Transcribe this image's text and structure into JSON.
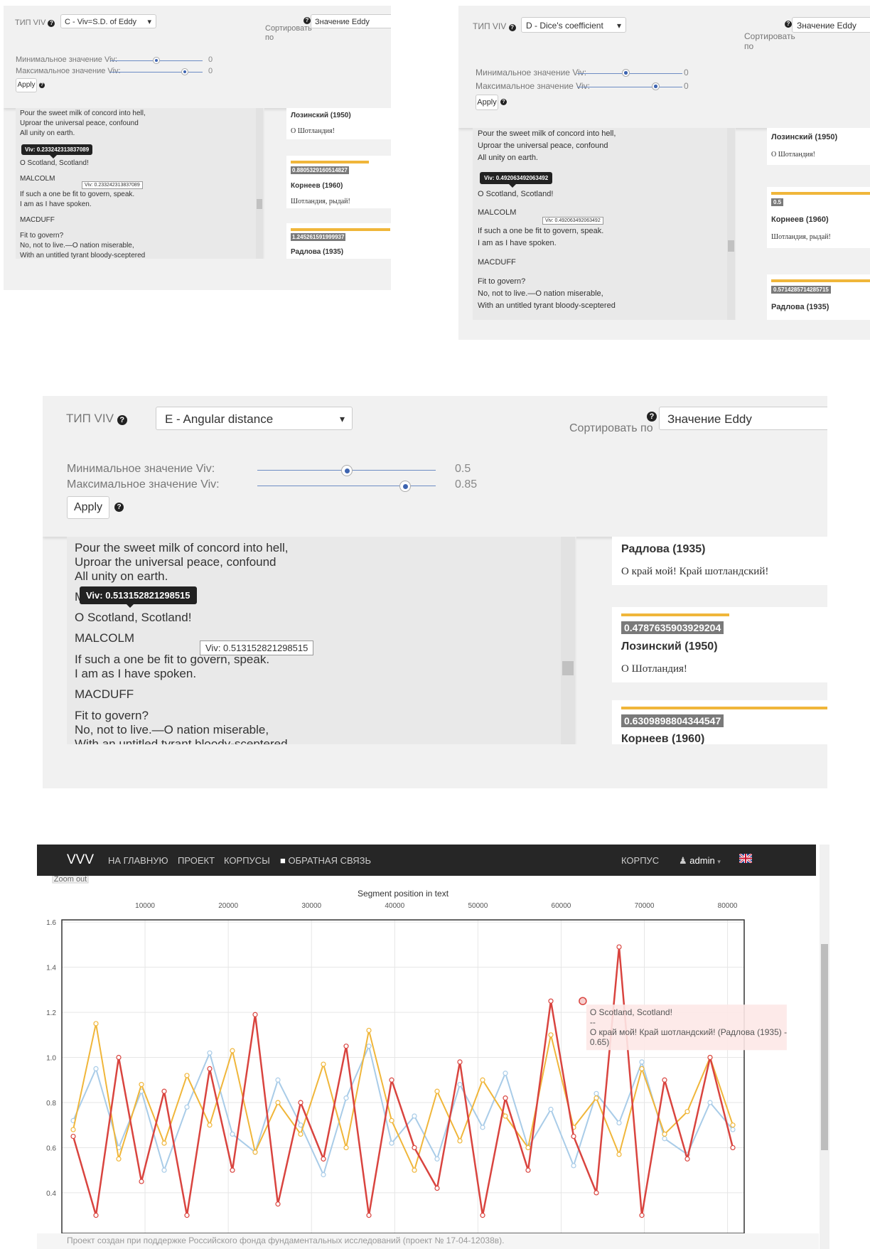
{
  "common": {
    "viv_type_label": "ТИП VIV",
    "help_glyph": "?",
    "sort_label": "Сортировать по",
    "sort_value": "Значение Eddy",
    "min_label": "Минимальное значение Viv:",
    "max_label": "Максимальное значение Viv:",
    "apply_label": "Apply",
    "caret": "▾",
    "text_lines": {
      "l1": "Pour the sweet milk of concord into hell,",
      "l2": "Uproar the universal peace, confound",
      "l3": "All unity on earth.",
      "l4": "O Scotland, Scotland!",
      "l5": "MALCOLM",
      "l6": "If such a one be fit to govern, speak.",
      "l7": "I am as I have spoken.",
      "l8": "MACDUFF",
      "l9": "Fit to govern?",
      "l10": "No, not to live.—O nation miserable,",
      "l11": "With an untitled tyrant bloody-sceptered"
    },
    "malcolm_initial": "M"
  },
  "panel1": {
    "viv_type": "C - Viv=S.D. of Eddy",
    "min_value": "0",
    "max_value": "0",
    "min_level": 0.42,
    "max_level": 0.7,
    "tooltip_dark": "Viv: 0.233242313837089",
    "tooltip_light": "Viv: 0.233242313837089",
    "cards": [
      {
        "score": "",
        "author": "Лозинский (1950)",
        "line": "О Шотландия!"
      },
      {
        "score": "0.8805329160514827",
        "author": "Корнеев (1960)",
        "line": "Шотландия, рыдай!"
      },
      {
        "score": "1.245261591999937",
        "author": "Радлова (1935)",
        "line": ""
      }
    ]
  },
  "panel2": {
    "viv_type": "D - Dice's coefficient",
    "min_value": "0",
    "max_value": "0",
    "min_level": 0.45,
    "max_level": 0.71,
    "tooltip_dark": "Viv: 0.492063492063492",
    "tooltip_light": "Viv: 0.492063492063492",
    "cards": [
      {
        "score": "",
        "author": "Лозинский (1950)",
        "line": "О Шотландия!"
      },
      {
        "score": "0.5",
        "author": "Корнеев (1960)",
        "line": "Шотландия, рыдай!"
      },
      {
        "score": "0.5714285714285715",
        "author": "Радлова (1935)",
        "line": ""
      }
    ]
  },
  "panel3": {
    "viv_type": "E - Angular distance",
    "min_value": "0.5",
    "max_value": "0.85",
    "min_level": 0.5,
    "max_level": 0.85,
    "tooltip_dark": "Viv: 0.513152821298515",
    "tooltip_light": "Viv: 0.513152821298515",
    "cards": [
      {
        "score": "",
        "author": "Радлова (1935)",
        "line": "О край мой! Край шотландский!"
      },
      {
        "score": "0.4787635903929204",
        "author": "Лозинский (1950)",
        "line": "О Шотландия!"
      },
      {
        "score": "0.6309898804344547",
        "author": "Корнеев (1960)",
        "line": ""
      }
    ]
  },
  "navbar": {
    "brand": "VVV",
    "items": [
      "НА ГЛАВНУЮ",
      "ПРОЕКТ",
      "КОРПУСЫ"
    ],
    "feedback": "ОБРАТНАЯ СВЯЗЬ",
    "corpus": "КОРПУС",
    "user": "admin",
    "flag": "gb-flag-icon"
  },
  "chart_data": {
    "type": "line",
    "title": "",
    "xlabel": "Segment position in text",
    "ylabel": "",
    "x_ticks": [
      10000,
      20000,
      30000,
      40000,
      50000,
      60000,
      70000,
      80000
    ],
    "y_ticks": [
      0.4,
      0.6,
      0.8,
      1.0,
      1.2,
      1.4,
      1.6
    ],
    "y_tick_labels": [
      "0.4",
      "0.6",
      "0.8",
      "1.0",
      "1.2",
      "1.4",
      "1.6"
    ],
    "xlim": [
      0,
      82000
    ],
    "ylim": [
      0.22,
      1.61
    ],
    "zoom_out_label": "Zoom out",
    "series": [
      {
        "color": "#a9cce8",
        "values": [
          0.72,
          0.95,
          0.6,
          0.85,
          0.5,
          0.78,
          1.02,
          0.66,
          0.58,
          0.9,
          0.7,
          0.48,
          0.82,
          1.05,
          0.62,
          0.74,
          0.55,
          0.88,
          0.69,
          0.93,
          0.6,
          0.77,
          0.52,
          0.84,
          0.71,
          0.98,
          0.64,
          0.57,
          0.8,
          0.68
        ]
      },
      {
        "color": "#f0b63a",
        "values": [
          0.68,
          1.15,
          0.55,
          0.88,
          0.62,
          0.92,
          0.7,
          1.03,
          0.58,
          0.8,
          0.66,
          0.97,
          0.6,
          1.12,
          0.72,
          0.5,
          0.85,
          0.63,
          0.9,
          0.74,
          0.6,
          1.1,
          0.69,
          0.82,
          0.57,
          0.95,
          0.66,
          0.76,
          1.0,
          0.7
        ]
      },
      {
        "color": "#d9443f",
        "values": [
          0.65,
          0.3,
          1.0,
          0.45,
          0.85,
          0.3,
          0.95,
          0.5,
          1.19,
          0.35,
          0.8,
          0.55,
          1.05,
          0.3,
          0.9,
          0.6,
          0.42,
          0.98,
          0.3,
          0.82,
          0.5,
          1.25,
          0.65,
          0.4,
          1.49,
          0.3,
          0.9,
          0.55,
          1.0,
          0.6
        ]
      }
    ],
    "highlight_point": {
      "x": 62600,
      "y": 1.25
    },
    "tooltip": {
      "line1": "O Scotland, Scotland!",
      "line2": "--",
      "line3": "О край мой! Край шотландский! (Радлова (1935) - 0.65)"
    }
  },
  "footer": {
    "text": "Проект создан при поддержке Российского фонда фундаментальных исследований (проект № 17-04-12038в)."
  }
}
